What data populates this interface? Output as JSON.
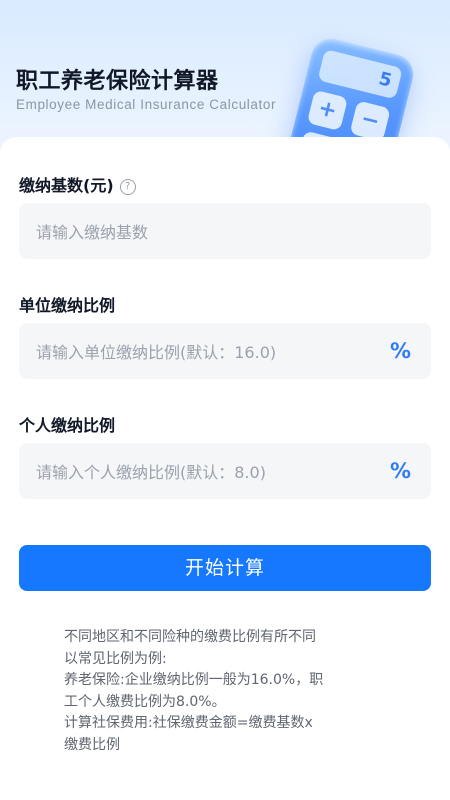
{
  "header": {
    "title": "职工养老保险计算器",
    "subtitle": "Employee Medical Insurance Calculator",
    "calculator": {
      "display": "5",
      "keys": [
        "+",
        "−",
        "÷",
        "="
      ]
    }
  },
  "form": {
    "base": {
      "label": "缴纳基数(元)",
      "help": "?",
      "placeholder": "请输入缴纳基数"
    },
    "company_rate": {
      "label": "单位缴纳比例",
      "placeholder": "请输入单位缴纳比例(默认：16.0)",
      "unit": "%"
    },
    "personal_rate": {
      "label": "个人缴纳比例",
      "placeholder": "请输入个人缴纳比例(默认：8.0)",
      "unit": "%"
    },
    "submit_label": "开始计算"
  },
  "notes": {
    "lines": [
      "不同地区和不同险种的缴费比例有所不同\n以常见比例为例:",
      "养老保险:企业缴纳比例一般为16.0%，职\n工个人缴费比例为8.0%。",
      "计算社保费用:社保缴费金额=缴费基数x\n缴费比例"
    ]
  },
  "colors": {
    "accent": "#1677ff",
    "percent": "#2f7cf6",
    "hero_bg": "#dcebff"
  }
}
